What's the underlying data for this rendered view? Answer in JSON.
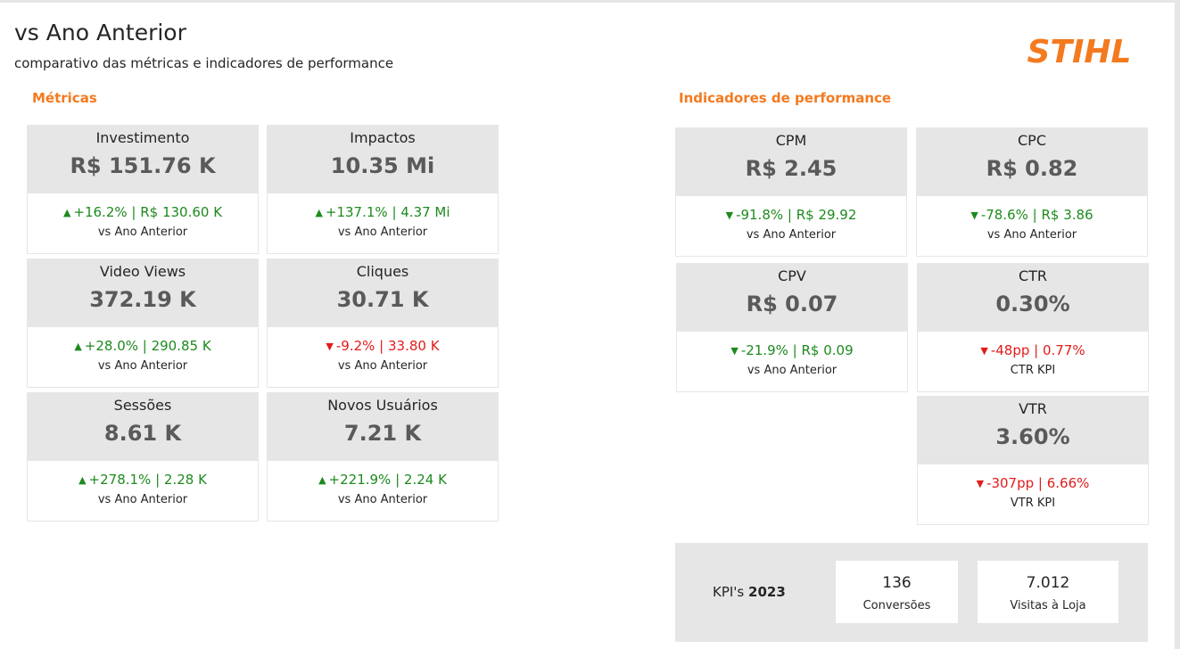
{
  "header": {
    "title": "vs Ano Anterior",
    "subtitle": "comparativo das métricas e indicadores de performance",
    "logo_text": "STIHL",
    "brand_color": "#f37a1f"
  },
  "colors": {
    "up": "#1e8a1e",
    "down": "#e31b1b",
    "card_bg": "#e6e6e6"
  },
  "metricas": {
    "title": "Métricas",
    "cards": [
      {
        "label": "Investimento",
        "value": "R$ 151.76 K",
        "delta": "+16.2% | R$ 130.60 K",
        "direction": "up",
        "caption": "vs Ano Anterior"
      },
      {
        "label": "Impactos",
        "value": "10.35 Mi",
        "delta": "+137.1% | 4.37 Mi",
        "direction": "up",
        "caption": "vs Ano Anterior"
      },
      {
        "label": "Video Views",
        "value": "372.19 K",
        "delta": "+28.0% | 290.85 K",
        "direction": "up",
        "caption": "vs Ano Anterior"
      },
      {
        "label": "Cliques",
        "value": "30.71 K",
        "delta": "-9.2% | 33.80 K",
        "direction": "down",
        "caption": "vs Ano Anterior"
      },
      {
        "label": "Sessões",
        "value": "8.61 K",
        "delta": "+278.1% | 2.28 K",
        "direction": "up",
        "caption": "vs Ano Anterior"
      },
      {
        "label": "Novos Usuários",
        "value": "7.21 K",
        "delta": "+221.9% | 2.24 K",
        "direction": "up",
        "caption": "vs Ano Anterior"
      }
    ]
  },
  "indicadores": {
    "title": "Indicadores de performance",
    "cards": [
      {
        "label": "CPM",
        "value": "R$ 2.45",
        "delta": "-91.8% | R$ 29.92",
        "direction": "down-good",
        "caption": "vs Ano Anterior"
      },
      {
        "label": "CPC",
        "value": "R$ 0.82",
        "delta": "-78.6% | R$ 3.86",
        "direction": "down-good",
        "caption": "vs Ano Anterior"
      },
      {
        "label": "CPV",
        "value": "R$ 0.07",
        "delta": "-21.9% | R$ 0.09",
        "direction": "down-good",
        "caption": "vs Ano Anterior"
      },
      {
        "label": "CTR",
        "value": "0.30%",
        "delta": "-48pp | 0.77%",
        "direction": "down",
        "caption": "CTR KPI"
      },
      {
        "label": "VTR",
        "value": "3.60%",
        "delta": "-307pp | 6.66%",
        "direction": "down",
        "caption": "VTR KPI"
      }
    ]
  },
  "kpis": {
    "label_prefix": "KPI's ",
    "year": "2023",
    "items": [
      {
        "value": "136",
        "label": "Conversões"
      },
      {
        "value": "7.012",
        "label": "Visitas à Loja"
      }
    ]
  }
}
